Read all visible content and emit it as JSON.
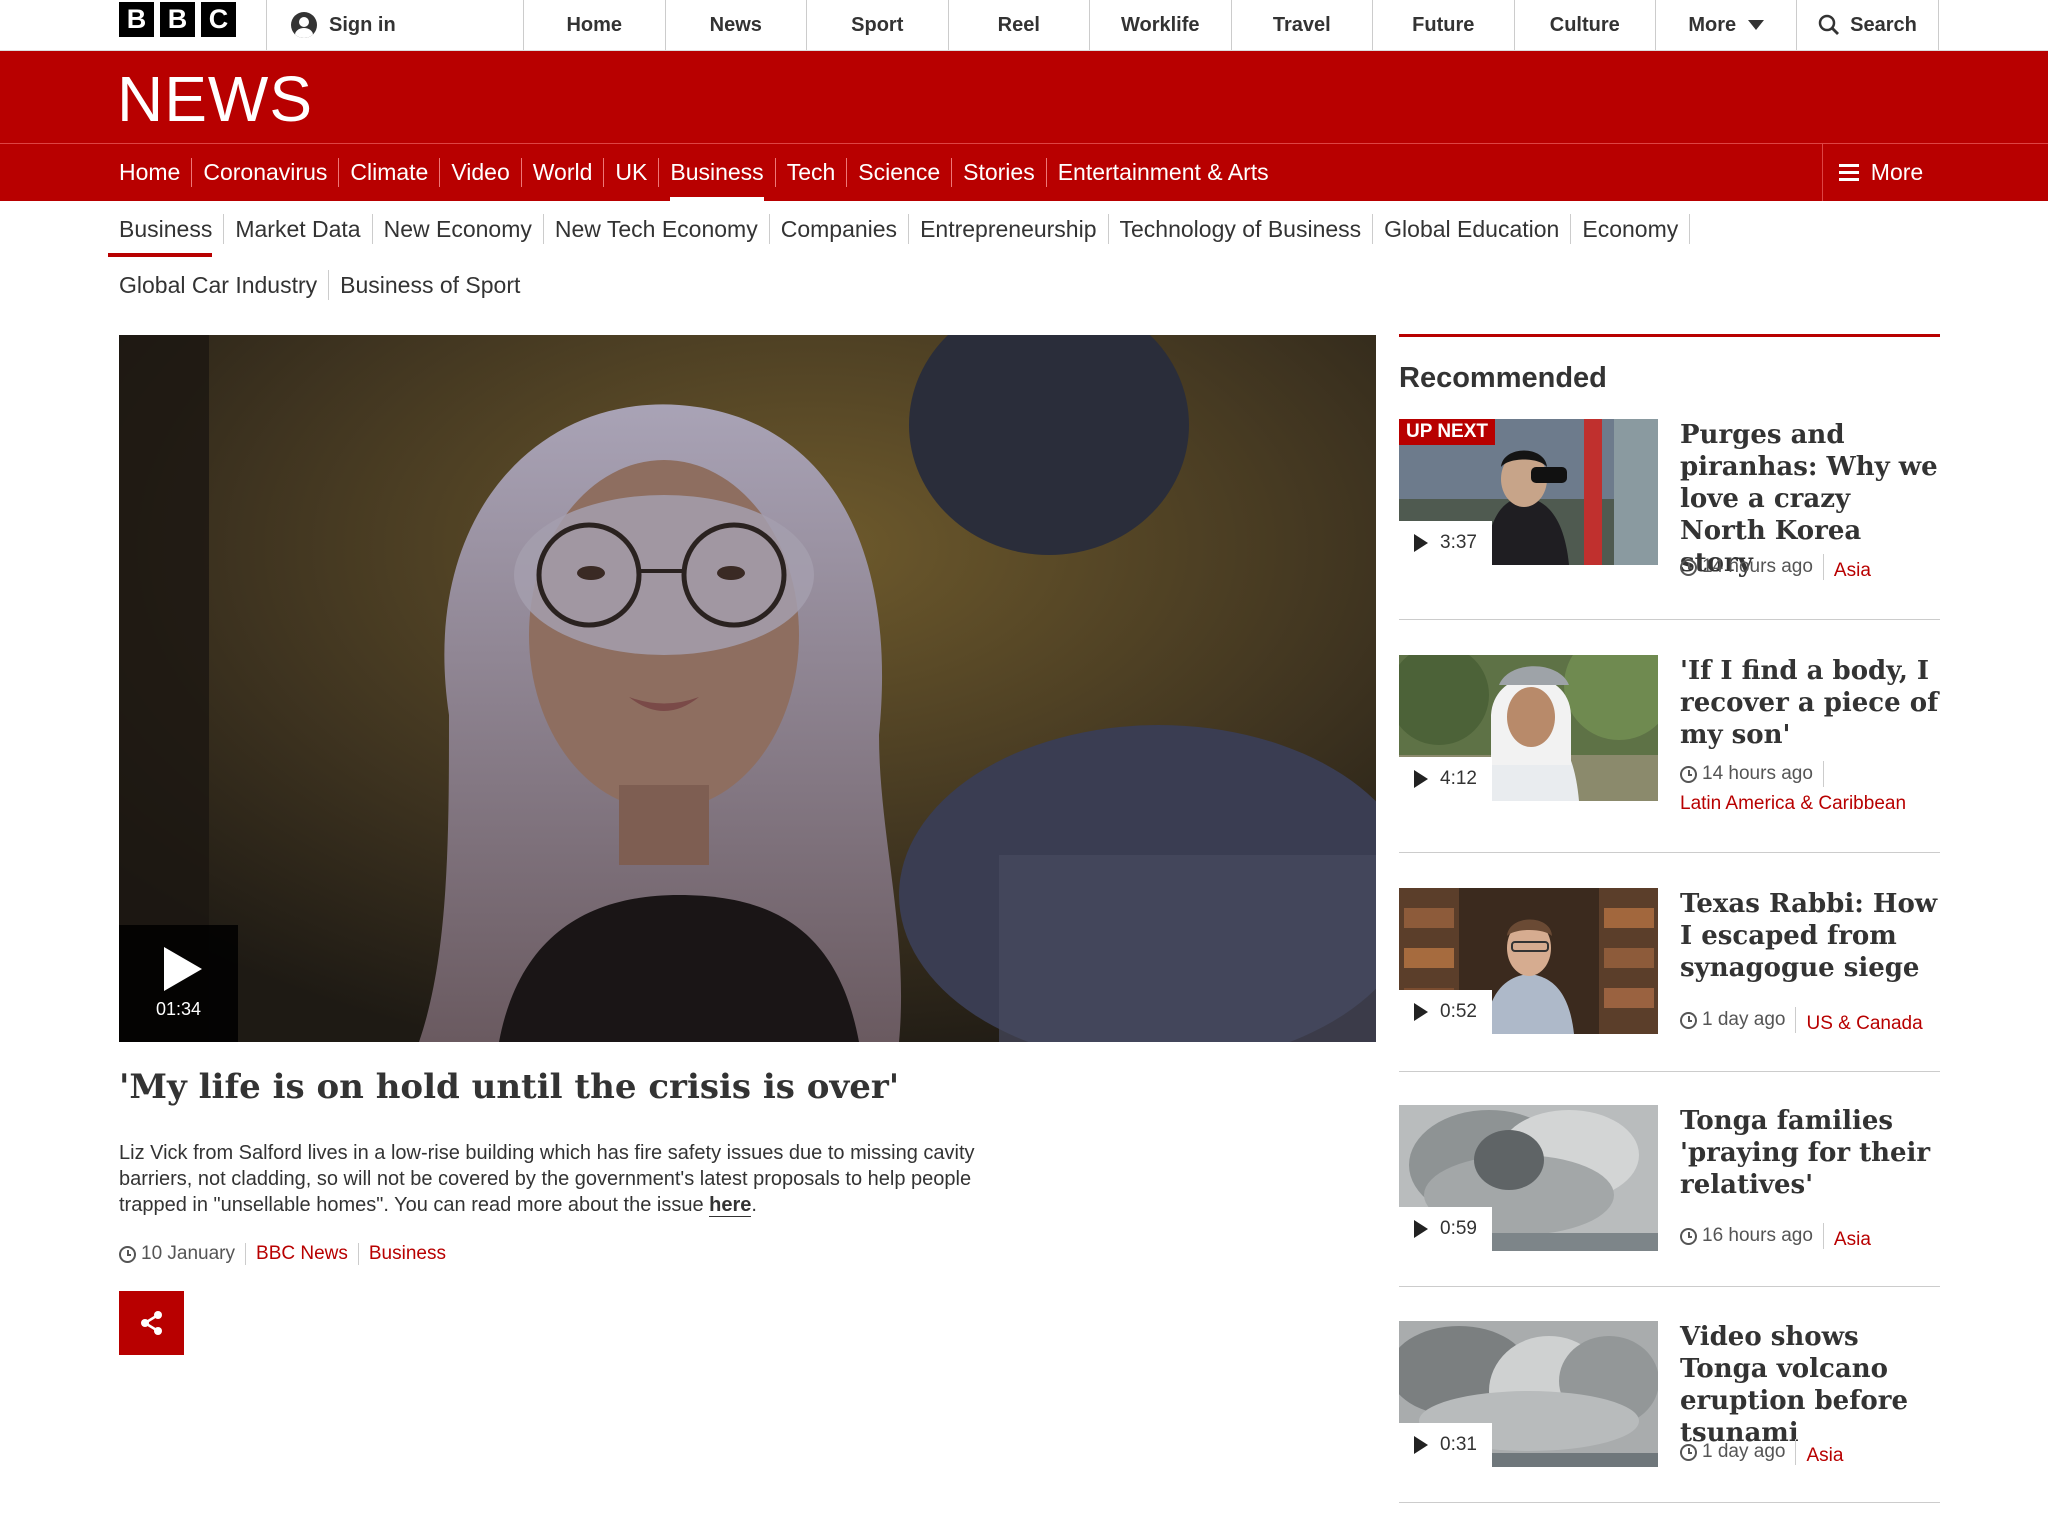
{
  "topbar": {
    "logo_letters": [
      "B",
      "B",
      "C"
    ],
    "sign_in": "Sign in",
    "nav": [
      "Home",
      "News",
      "Sport",
      "Reel",
      "Worklife",
      "Travel",
      "Future",
      "Culture"
    ],
    "more": "More",
    "search": "Search"
  },
  "news_header": {
    "wordmark": "NEWS",
    "nav": [
      "Home",
      "Coronavirus",
      "Climate",
      "Video",
      "World",
      "UK",
      "Business",
      "Tech",
      "Science",
      "Stories",
      "Entertainment & Arts"
    ],
    "active": "Business",
    "more": "More"
  },
  "subnav": {
    "row1": [
      "Business",
      "Market Data",
      "New Economy",
      "New Tech Economy",
      "Companies",
      "Entrepreneurship",
      "Technology of Business",
      "Global Education",
      "Economy"
    ],
    "row2": [
      "Global Car Industry",
      "Business of Sport"
    ],
    "active": "Business"
  },
  "main": {
    "video_duration": "01:34",
    "headline": "'My life is on hold until the crisis is over'",
    "summary_text": "Liz Vick from Salford lives in a low-rise building which has fire safety issues due to missing cavity barriers, not cladding, so will not be covered by the government's latest proposals to help people trapped in \"unsellable homes\". You can read more about the issue ",
    "summary_link": "here",
    "summary_end": ".",
    "date": "10 January",
    "source": "BBC News",
    "section": "Business"
  },
  "recommended": {
    "title": "Recommended",
    "up_next": "UP NEXT",
    "items": [
      {
        "title": "Purges and piranhas: Why we love a crazy North Korea story",
        "duration": "3:37",
        "time": "14 hours ago",
        "category": "Asia"
      },
      {
        "title": "'If I find a body, I recover a piece of my son'",
        "duration": "4:12",
        "time": "14 hours ago",
        "category": "Latin America & Caribbean"
      },
      {
        "title": "Texas Rabbi: How I escaped from synagogue siege",
        "duration": "0:52",
        "time": "1 day ago",
        "category": "US & Canada"
      },
      {
        "title": "Tonga families 'praying for their relatives'",
        "duration": "0:59",
        "time": "16 hours ago",
        "category": "Asia"
      },
      {
        "title": "Video shows Tonga volcano eruption before tsunami",
        "duration": "0:31",
        "time": "1 day ago",
        "category": "Asia"
      }
    ]
  },
  "colors": {
    "brand_red": "#b80000",
    "text": "#333333"
  }
}
